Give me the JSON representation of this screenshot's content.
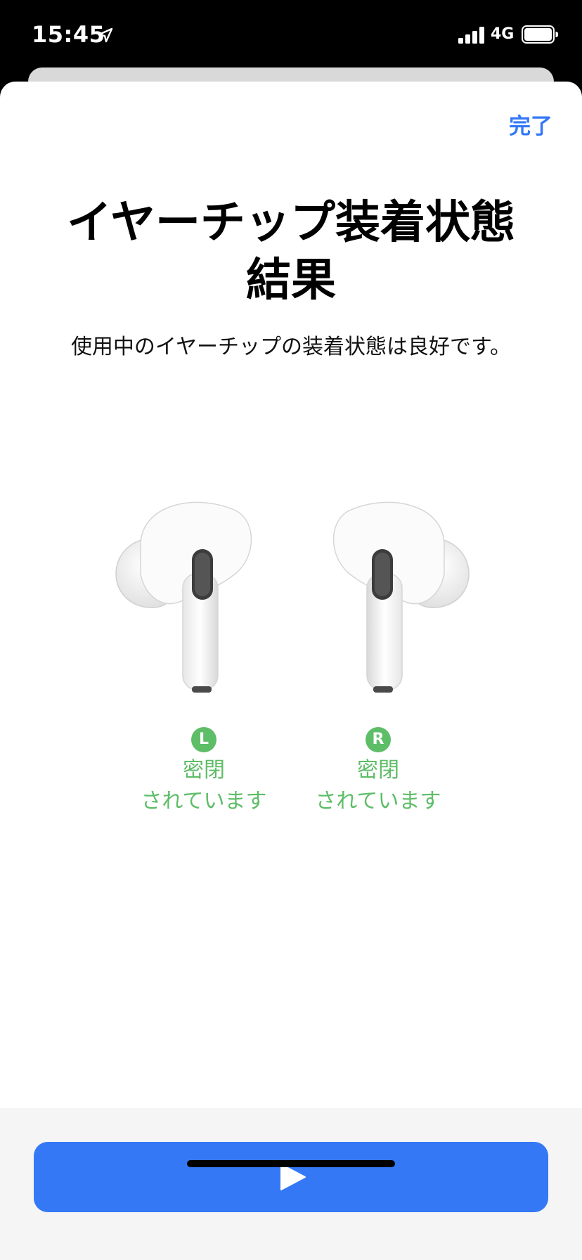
{
  "status_bar": {
    "time": "15:45",
    "network": "4G",
    "location_icon": "location-arrow-icon",
    "signal_icon": "cellular-signal-icon",
    "battery_icon": "battery-icon"
  },
  "header": {
    "done_label": "完了"
  },
  "main": {
    "title_line1": "イヤーチップ装着状態",
    "title_line2": "結果",
    "subtitle": "使用中のイヤーチップの装着状態は良好です。"
  },
  "results": [
    {
      "side": "L",
      "line1": "密閉",
      "line2": "されています"
    },
    {
      "side": "R",
      "line1": "密閉",
      "line2": "されています"
    }
  ],
  "footer": {
    "play_icon": "play-icon"
  },
  "colors": {
    "accent": "#3478f6",
    "success": "#5ebd67"
  }
}
